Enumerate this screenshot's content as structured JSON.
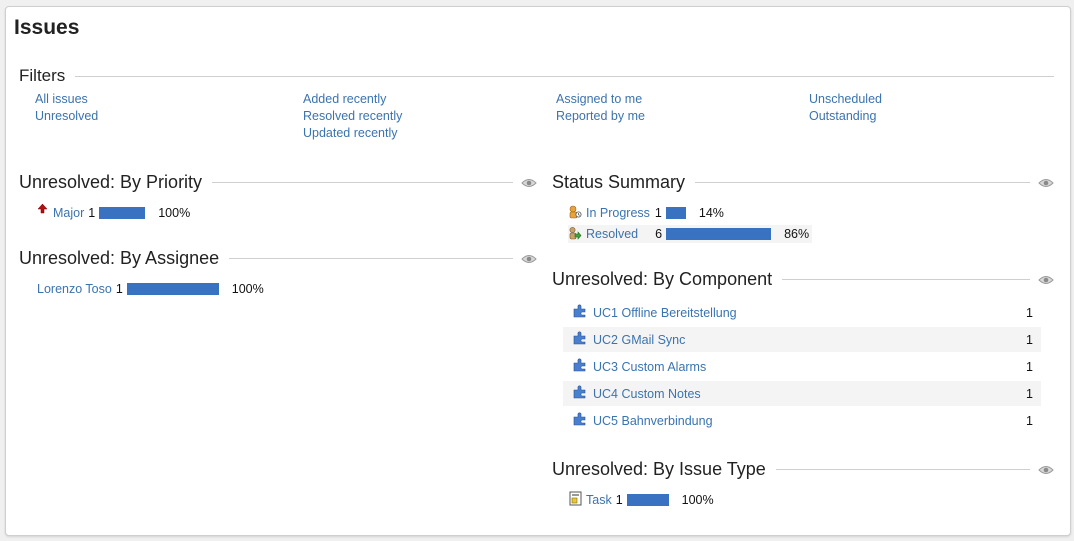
{
  "page": {
    "title": "Issues"
  },
  "filters": {
    "heading": "Filters",
    "columns": [
      [
        "All issues",
        "Unresolved"
      ],
      [
        "Added recently",
        "Resolved recently",
        "Updated recently"
      ],
      [
        "Assigned to me",
        "Reported by me"
      ],
      [
        "Unscheduled",
        "Outstanding"
      ]
    ]
  },
  "by_priority": {
    "heading": "Unresolved: By Priority",
    "rows": [
      {
        "label": "Major",
        "count": "1",
        "percent": "100%",
        "fraction": 1.0
      }
    ]
  },
  "by_assignee": {
    "heading": "Unresolved: By Assignee",
    "rows": [
      {
        "label": "Lorenzo Toso",
        "count": "1",
        "percent": "100%",
        "fraction": 1.0
      }
    ]
  },
  "status_summary": {
    "heading": "Status Summary",
    "rows": [
      {
        "label": "In Progress",
        "count": "1",
        "percent": "14%",
        "fraction": 0.14
      },
      {
        "label": "Resolved",
        "count": "6",
        "percent": "86%",
        "fraction": 0.86
      }
    ]
  },
  "by_component": {
    "heading": "Unresolved: By Component",
    "rows": [
      {
        "label": "UC1 Offline Bereitstellung",
        "count": "1"
      },
      {
        "label": "UC2 GMail Sync",
        "count": "1"
      },
      {
        "label": "UC3 Custom Alarms",
        "count": "1"
      },
      {
        "label": "UC4 Custom Notes",
        "count": "1"
      },
      {
        "label": "UC5 Bahnverbindung",
        "count": "1"
      }
    ]
  },
  "by_issue_type": {
    "heading": "Unresolved: By Issue Type",
    "rows": [
      {
        "label": "Task",
        "count": "1",
        "percent": "100%",
        "fraction": 1.0
      }
    ]
  },
  "icons": {
    "eye": "eye-icon",
    "priority_major": "arrow-up-icon",
    "status_in_progress": "in-progress-icon",
    "status_resolved": "resolved-icon",
    "component": "puzzle-icon",
    "task": "task-icon"
  },
  "colors": {
    "bar": "#3972c1",
    "link": "#3b73af",
    "rule": "#cfcfcf",
    "alt_row": "#f4f4f4"
  }
}
